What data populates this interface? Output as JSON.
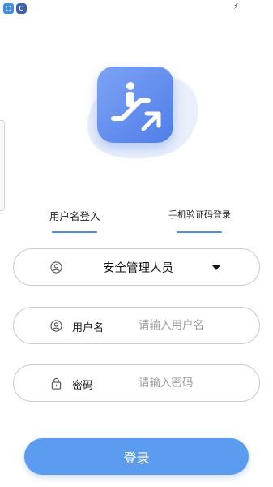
{
  "status_bar": {
    "icons": [
      "app-notification-icon",
      "browser-notification-icon",
      "charging-icon"
    ]
  },
  "logo": {
    "icon": "escalator-icon",
    "color": "#5b88ec"
  },
  "tabs": [
    {
      "label": "用户名登入",
      "active": true
    },
    {
      "label": "手机验证码登录",
      "active": false
    }
  ],
  "form": {
    "role": {
      "value": "安全管理人员",
      "icon": "user-icon"
    },
    "username": {
      "label": "用户名",
      "placeholder": "请输入用户名",
      "value": "",
      "icon": "user-icon"
    },
    "password": {
      "label": "密码",
      "placeholder": "请输入密码",
      "value": "",
      "icon": "lock-icon"
    }
  },
  "login_button": {
    "label": "登录"
  },
  "colors": {
    "accent": "#4a8fe6",
    "button": "#5b9bf0",
    "border": "#c9cdd2"
  }
}
